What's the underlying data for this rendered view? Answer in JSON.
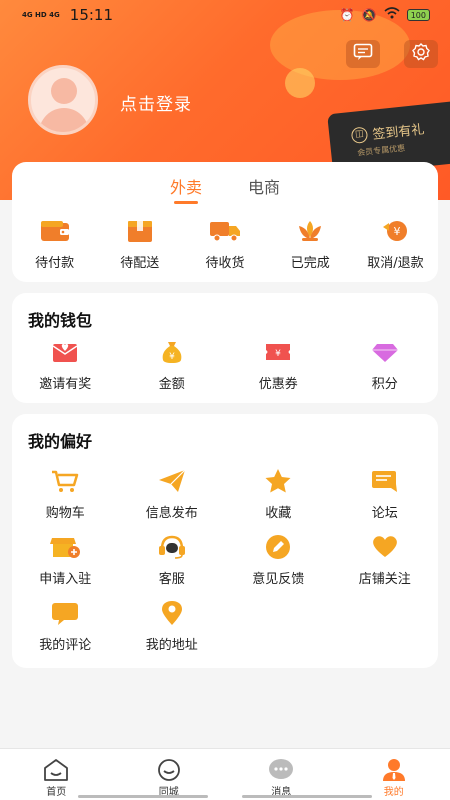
{
  "status": {
    "network": "4G HD 4G",
    "time": "15:11",
    "battery": "100"
  },
  "header": {
    "login_text": "点击登录",
    "signin_title": "签到有礼",
    "signin_sub": "会员专属优惠"
  },
  "orders": {
    "tabs": [
      {
        "label": "外卖"
      },
      {
        "label": "电商"
      }
    ],
    "items": [
      {
        "label": "待付款",
        "icon": "wallet-icon"
      },
      {
        "label": "待配送",
        "icon": "package-icon"
      },
      {
        "label": "待收货",
        "icon": "truck-icon"
      },
      {
        "label": "已完成",
        "icon": "lotus-icon"
      },
      {
        "label": "取消/退款",
        "icon": "refund-icon"
      }
    ]
  },
  "wallet": {
    "title": "我的钱包",
    "items": [
      {
        "label": "邀请有奖",
        "icon": "envelope-heart-icon"
      },
      {
        "label": "金额",
        "icon": "money-bag-icon"
      },
      {
        "label": "优惠券",
        "icon": "coupon-icon"
      },
      {
        "label": "积分",
        "icon": "diamond-icon"
      }
    ]
  },
  "prefs": {
    "title": "我的偏好",
    "rows": [
      [
        {
          "label": "购物车"
        },
        {
          "label": "信息发布"
        },
        {
          "label": "收藏"
        },
        {
          "label": "论坛"
        }
      ],
      [
        {
          "label": "申请入驻"
        },
        {
          "label": "客服"
        },
        {
          "label": "意见反馈"
        },
        {
          "label": "店铺关注"
        }
      ],
      [
        {
          "label": "我的评论"
        },
        {
          "label": "我的地址"
        }
      ]
    ]
  },
  "nav": [
    {
      "label": "首页"
    },
    {
      "label": "同城"
    },
    {
      "label": "消息"
    },
    {
      "label": "我的"
    }
  ],
  "colors": {
    "accent": "#ff7a2a",
    "icon_orange": "#f5a623",
    "icon_red": "#f0524f"
  }
}
